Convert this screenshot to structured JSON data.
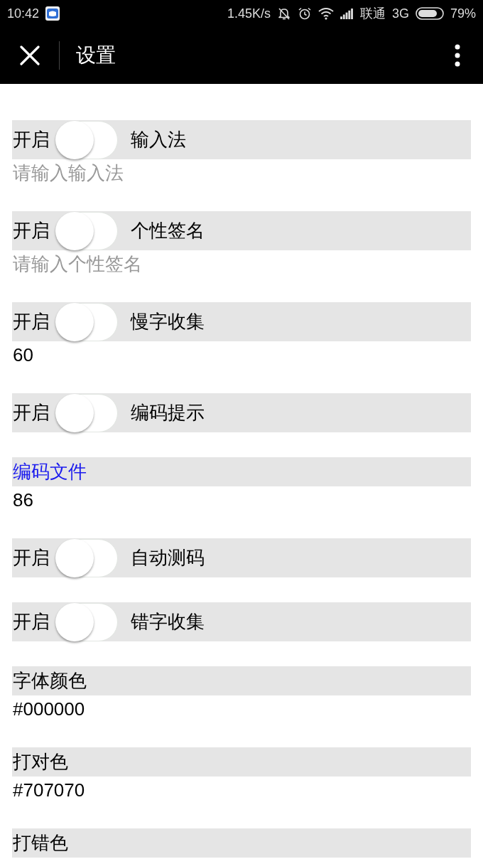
{
  "status_bar": {
    "time": "10:42",
    "speed": "1.45K/s",
    "carrier": "联通",
    "network": "3G",
    "battery": "79%"
  },
  "app_bar": {
    "title": "设置"
  },
  "settings": [
    {
      "kind": "toggle",
      "switch_label": "开启",
      "on": false,
      "title": "输入法",
      "field": {
        "placeholder": "请输入输入法"
      }
    },
    {
      "kind": "toggle",
      "switch_label": "开启",
      "on": false,
      "title": "个性签名",
      "field": {
        "placeholder": "请输入个性签名"
      }
    },
    {
      "kind": "toggle",
      "switch_label": "开启",
      "on": false,
      "title": "慢字收集",
      "field": {
        "value": "60"
      }
    },
    {
      "kind": "toggle",
      "switch_label": "开启",
      "on": false,
      "title": "编码提示"
    },
    {
      "kind": "file",
      "title": "编码文件",
      "field": {
        "value": "86"
      }
    },
    {
      "kind": "toggle",
      "switch_label": "开启",
      "on": false,
      "title": "自动测码"
    },
    {
      "kind": "toggle",
      "switch_label": "开启",
      "on": false,
      "title": "错字收集"
    },
    {
      "kind": "text",
      "title": "字体颜色",
      "field": {
        "value": "#000000"
      }
    },
    {
      "kind": "text",
      "title": "打对色",
      "field": {
        "value": "#707070"
      }
    },
    {
      "kind": "text",
      "title": "打错色"
    }
  ]
}
